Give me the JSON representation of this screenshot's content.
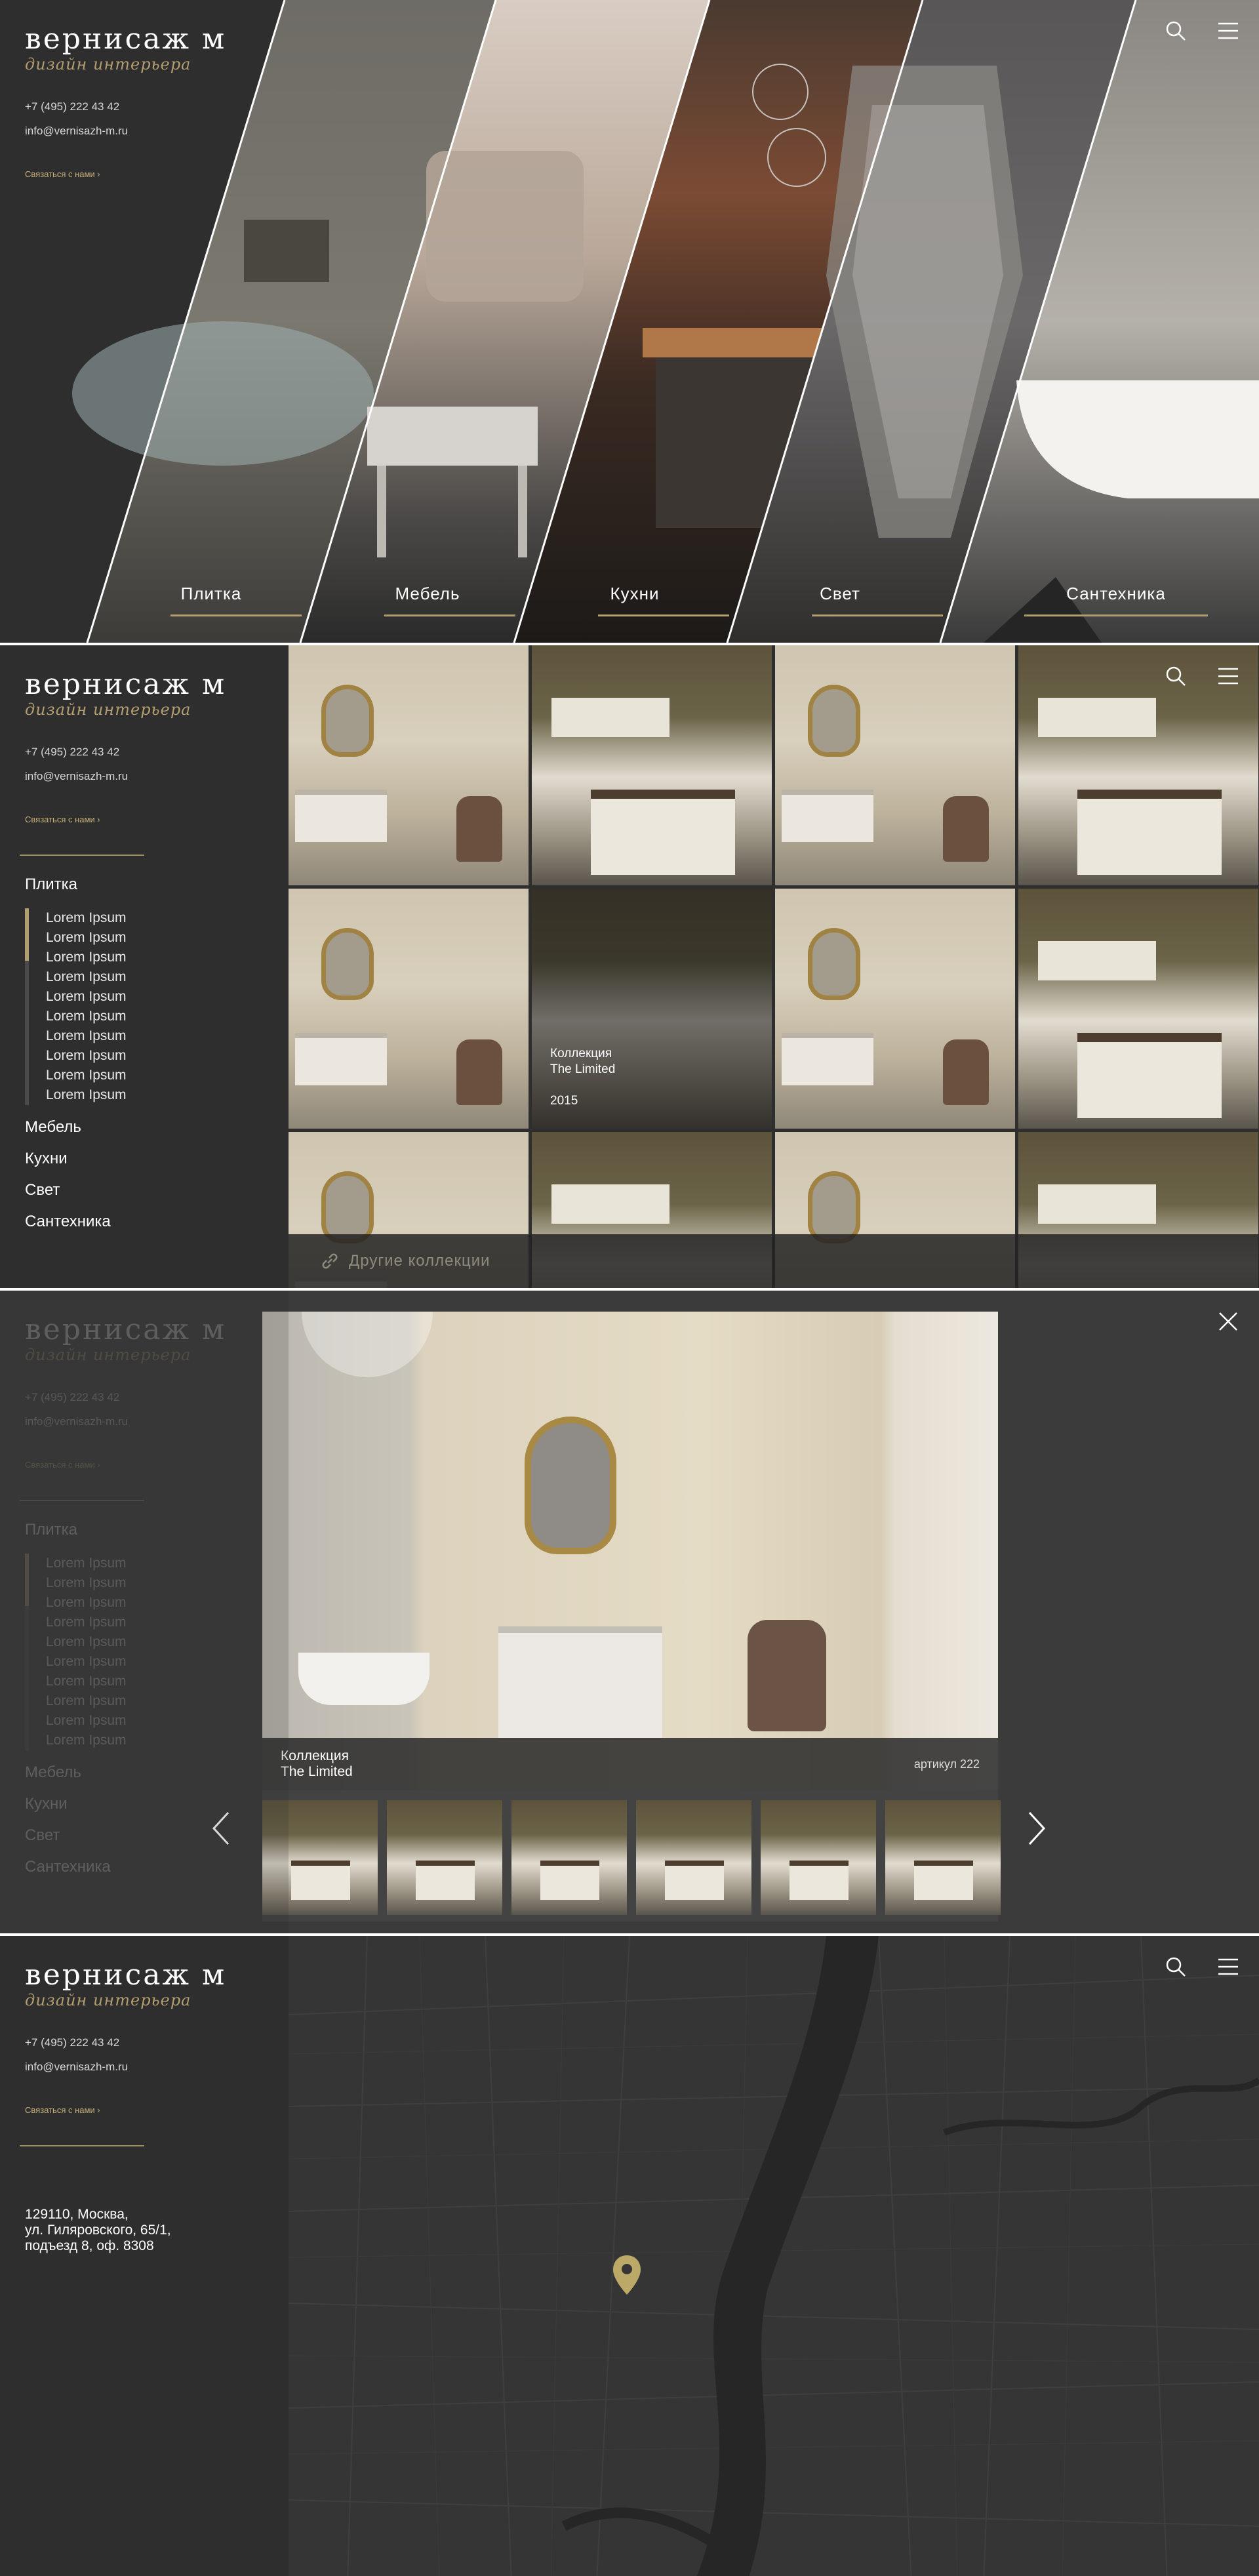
{
  "brand": {
    "logo_main": "вернисаж м",
    "logo_sub": "дизайн интерьера",
    "colors": {
      "accent": "#b39e6f",
      "sidebar": "#2e2e2e",
      "text": "#ffffff"
    }
  },
  "contacts": {
    "phone": "+7 (495) 222 43 42",
    "email": "info@vernisazh-m.ru",
    "contact_link": "Связаться с нами ›"
  },
  "icons": {
    "search": "search-icon",
    "menu": "hamburger-menu-icon",
    "close": "close-icon",
    "link": "link-icon",
    "pin": "map-pin-icon",
    "prev": "chevron-left-icon",
    "next": "chevron-right-icon"
  },
  "categories": [
    "Плитка",
    "Мебель",
    "Кухни",
    "Свет",
    "Сантехника"
  ],
  "catalog": {
    "active_category": "Плитка",
    "subcategories": [
      "Lorem Ipsum",
      "Lorem Ipsum",
      "Lorem Ipsum",
      "Lorem Ipsum",
      "Lorem Ipsum",
      "Lorem Ipsum",
      "Lorem Ipsum",
      "Lorem Ipsum",
      "Lorem Ipsum",
      "Lorem Ipsum"
    ],
    "other_categories": [
      "Мебель",
      "Кухни",
      "Свет",
      "Сантехника"
    ],
    "hover_tile": {
      "label_line1": "Коллекция",
      "label_line2": "The Limited",
      "year": "2015"
    },
    "more_collections": "Другие коллекции"
  },
  "modal": {
    "collection_line1": "Коллекция",
    "collection_line2": "The Limited",
    "article": "артикул 222",
    "thumb_count": 6
  },
  "contacts_page": {
    "address_line1": "129110, Москва,",
    "address_line2": "ул. Гиляровского, 65/1,",
    "address_line3": "подъезд 8, оф. 8308"
  }
}
